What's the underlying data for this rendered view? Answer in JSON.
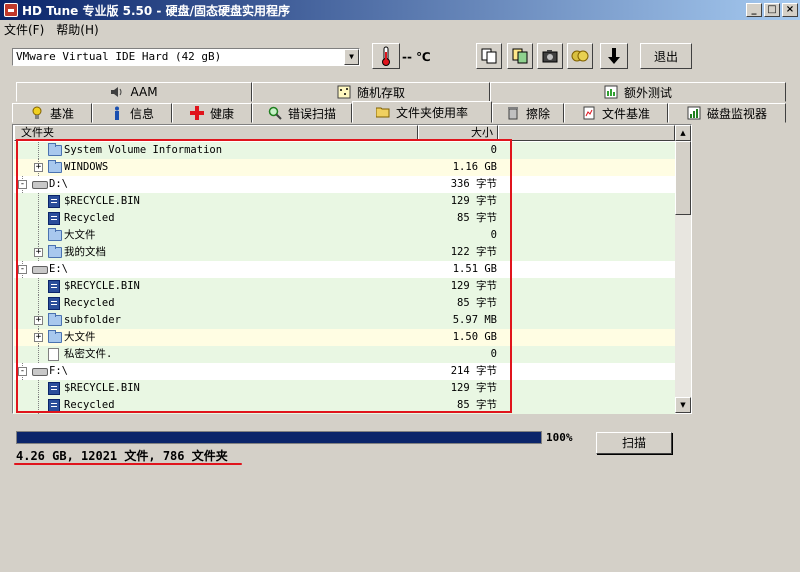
{
  "window": {
    "title": "HD Tune 专业版 5.50 - 硬盘/固态硬盘实用程序"
  },
  "menu": {
    "file": "文件(F)",
    "help": "帮助(H)"
  },
  "toolbar": {
    "drive": "VMware Virtual IDE Hard (42 gB)",
    "temperature": "-- ℃",
    "exit": "退出"
  },
  "tabs_top": [
    {
      "label": "AAM",
      "icon": "speaker-icon"
    },
    {
      "label": "随机存取",
      "icon": "random-access-icon"
    },
    {
      "label": "额外测试",
      "icon": "extra-tests-icon"
    }
  ],
  "tabs_bottom": [
    {
      "label": "基准",
      "icon": "lightbulb-icon"
    },
    {
      "label": "信息",
      "icon": "info-icon"
    },
    {
      "label": "健康",
      "icon": "health-cross-icon"
    },
    {
      "label": "错误扫描",
      "icon": "magnifier-icon"
    },
    {
      "label": "文件夹使用率",
      "icon": "folder-icon"
    },
    {
      "label": "擦除",
      "icon": "trash-icon"
    },
    {
      "label": "文件基准",
      "icon": "file-benchmark-icon"
    },
    {
      "label": "磁盘监视器",
      "icon": "disk-monitor-icon"
    }
  ],
  "table": {
    "headers": {
      "folder": "文件夹",
      "size": "大小"
    },
    "rows": [
      {
        "name": "System Volume Information",
        "size": "0",
        "type": "folder",
        "level": 2,
        "bg": "green",
        "expander": ""
      },
      {
        "name": "WINDOWS",
        "size": "1.16 GB",
        "type": "folder",
        "level": 2,
        "bg": "yellow",
        "expander": "+"
      },
      {
        "name": "D:\\",
        "size": "336 字节",
        "type": "drive",
        "level": 1,
        "bg": "white",
        "expander": "-"
      },
      {
        "name": "$RECYCLE.BIN",
        "size": "129 字节",
        "type": "sysfolder",
        "level": 2,
        "bg": "green",
        "expander": ""
      },
      {
        "name": "Recycled",
        "size": "85 字节",
        "type": "sysfolder",
        "level": 2,
        "bg": "green",
        "expander": ""
      },
      {
        "name": "大文件",
        "size": "0",
        "type": "folder",
        "level": 2,
        "bg": "green",
        "expander": ""
      },
      {
        "name": "我的文档",
        "size": "122 字节",
        "type": "folder",
        "level": 2,
        "bg": "green",
        "expander": "+"
      },
      {
        "name": "E:\\",
        "size": "1.51 GB",
        "type": "drive",
        "level": 1,
        "bg": "white",
        "expander": "-"
      },
      {
        "name": "$RECYCLE.BIN",
        "size": "129 字节",
        "type": "sysfolder",
        "level": 2,
        "bg": "green",
        "expander": ""
      },
      {
        "name": "Recycled",
        "size": "85 字节",
        "type": "sysfolder",
        "level": 2,
        "bg": "green",
        "expander": ""
      },
      {
        "name": "subfolder",
        "size": "5.97 MB",
        "type": "folder",
        "level": 2,
        "bg": "green",
        "expander": "+"
      },
      {
        "name": "大文件",
        "size": "1.50 GB",
        "type": "folder",
        "level": 2,
        "bg": "yellow",
        "expander": "+"
      },
      {
        "name": "私密文件.",
        "size": "0",
        "type": "file",
        "level": 2,
        "bg": "green",
        "expander": ""
      },
      {
        "name": "F:\\",
        "size": "214 字节",
        "type": "drive",
        "level": 1,
        "bg": "white",
        "expander": "-"
      },
      {
        "name": "$RECYCLE.BIN",
        "size": "129 字节",
        "type": "sysfolder",
        "level": 2,
        "bg": "green",
        "expander": ""
      },
      {
        "name": "Recycled",
        "size": "85 字节",
        "type": "sysfolder",
        "level": 2,
        "bg": "green",
        "expander": ""
      }
    ]
  },
  "progress": {
    "percent_label": "100%",
    "fraction": 1.0
  },
  "scan_button": "扫描",
  "summary": "4.26 GB, 12021 文件, 786 文件夹",
  "colors": {
    "highlight": "#e0141c",
    "progress": "#0a246a",
    "row_green": "#e9f7e3",
    "row_yellow": "#fffde3"
  }
}
